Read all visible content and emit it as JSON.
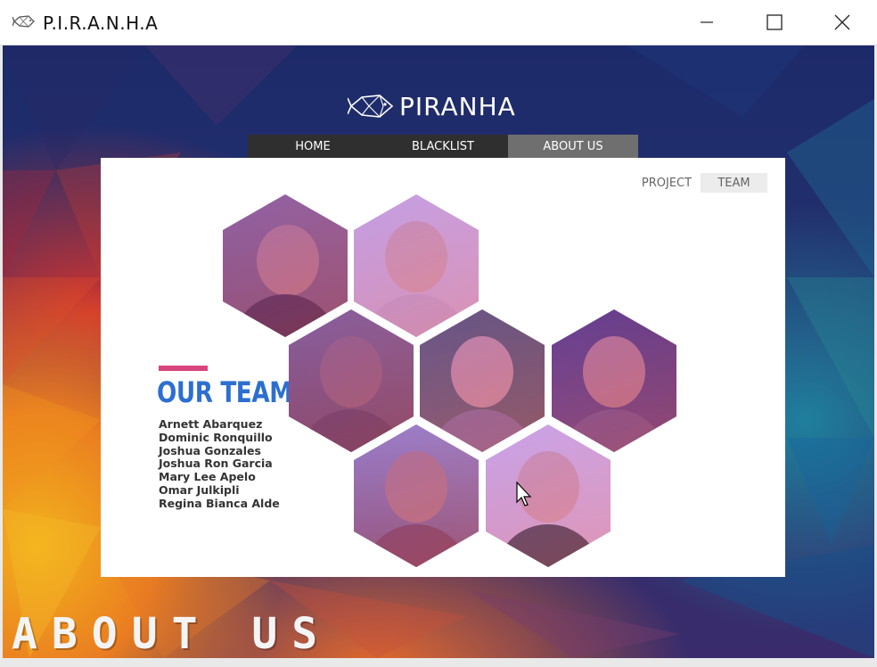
{
  "window": {
    "title": "P.I.R.A.N.H.A"
  },
  "header": {
    "logo_text": "PIRANHA"
  },
  "nav": {
    "items": [
      {
        "label": "HOME"
      },
      {
        "label": "BLACKLIST"
      },
      {
        "label": "ABOUT US"
      }
    ],
    "active": "ABOUT US"
  },
  "panel": {
    "subtabs": {
      "project": "PROJECT",
      "team": "TEAM"
    },
    "heading": "OUR TEAM",
    "names": [
      "Arnett Abarquez",
      "Dominic Ronquillo",
      "Joshua Gonzales",
      "Joshua Ron Garcia",
      "Mary Lee Apelo",
      "Omar Julkipli",
      "Regina Bianca Alde"
    ]
  },
  "footer": {
    "label": "ABOUT US"
  },
  "colors": {
    "accent_pink": "#d8457f",
    "heading_blue": "#2d6fd0",
    "nav_bg": "#2f2f2f",
    "nav_active": "#6f6f6f"
  },
  "icons": {
    "app": "fish-icon",
    "minimize": "minimize-icon",
    "maximize": "maximize-icon",
    "close": "close-icon"
  }
}
